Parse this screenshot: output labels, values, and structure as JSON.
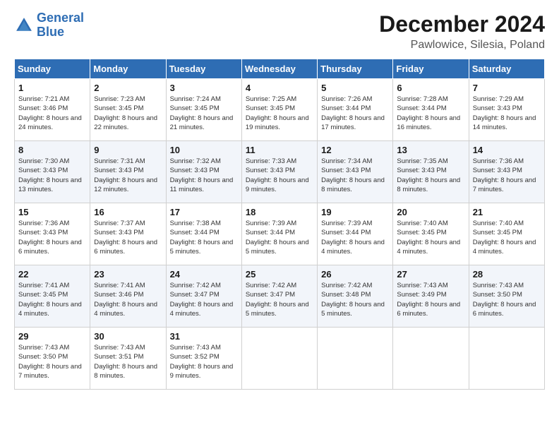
{
  "logo": {
    "line1": "General",
    "line2": "Blue"
  },
  "title": "December 2024",
  "subtitle": "Pawlowice, Silesia, Poland",
  "days_of_week": [
    "Sunday",
    "Monday",
    "Tuesday",
    "Wednesday",
    "Thursday",
    "Friday",
    "Saturday"
  ],
  "weeks": [
    [
      {
        "day": 1,
        "rise": "7:21 AM",
        "set": "3:46 PM",
        "daylight": "8 hours and 24 minutes."
      },
      {
        "day": 2,
        "rise": "7:23 AM",
        "set": "3:45 PM",
        "daylight": "8 hours and 22 minutes."
      },
      {
        "day": 3,
        "rise": "7:24 AM",
        "set": "3:45 PM",
        "daylight": "8 hours and 21 minutes."
      },
      {
        "day": 4,
        "rise": "7:25 AM",
        "set": "3:45 PM",
        "daylight": "8 hours and 19 minutes."
      },
      {
        "day": 5,
        "rise": "7:26 AM",
        "set": "3:44 PM",
        "daylight": "8 hours and 17 minutes."
      },
      {
        "day": 6,
        "rise": "7:28 AM",
        "set": "3:44 PM",
        "daylight": "8 hours and 16 minutes."
      },
      {
        "day": 7,
        "rise": "7:29 AM",
        "set": "3:43 PM",
        "daylight": "8 hours and 14 minutes."
      }
    ],
    [
      {
        "day": 8,
        "rise": "7:30 AM",
        "set": "3:43 PM",
        "daylight": "8 hours and 13 minutes."
      },
      {
        "day": 9,
        "rise": "7:31 AM",
        "set": "3:43 PM",
        "daylight": "8 hours and 12 minutes."
      },
      {
        "day": 10,
        "rise": "7:32 AM",
        "set": "3:43 PM",
        "daylight": "8 hours and 11 minutes."
      },
      {
        "day": 11,
        "rise": "7:33 AM",
        "set": "3:43 PM",
        "daylight": "8 hours and 9 minutes."
      },
      {
        "day": 12,
        "rise": "7:34 AM",
        "set": "3:43 PM",
        "daylight": "8 hours and 8 minutes."
      },
      {
        "day": 13,
        "rise": "7:35 AM",
        "set": "3:43 PM",
        "daylight": "8 hours and 8 minutes."
      },
      {
        "day": 14,
        "rise": "7:36 AM",
        "set": "3:43 PM",
        "daylight": "8 hours and 7 minutes."
      }
    ],
    [
      {
        "day": 15,
        "rise": "7:36 AM",
        "set": "3:43 PM",
        "daylight": "8 hours and 6 minutes."
      },
      {
        "day": 16,
        "rise": "7:37 AM",
        "set": "3:43 PM",
        "daylight": "8 hours and 6 minutes."
      },
      {
        "day": 17,
        "rise": "7:38 AM",
        "set": "3:44 PM",
        "daylight": "8 hours and 5 minutes."
      },
      {
        "day": 18,
        "rise": "7:39 AM",
        "set": "3:44 PM",
        "daylight": "8 hours and 5 minutes."
      },
      {
        "day": 19,
        "rise": "7:39 AM",
        "set": "3:44 PM",
        "daylight": "8 hours and 4 minutes."
      },
      {
        "day": 20,
        "rise": "7:40 AM",
        "set": "3:45 PM",
        "daylight": "8 hours and 4 minutes."
      },
      {
        "day": 21,
        "rise": "7:40 AM",
        "set": "3:45 PM",
        "daylight": "8 hours and 4 minutes."
      }
    ],
    [
      {
        "day": 22,
        "rise": "7:41 AM",
        "set": "3:45 PM",
        "daylight": "8 hours and 4 minutes."
      },
      {
        "day": 23,
        "rise": "7:41 AM",
        "set": "3:46 PM",
        "daylight": "8 hours and 4 minutes."
      },
      {
        "day": 24,
        "rise": "7:42 AM",
        "set": "3:47 PM",
        "daylight": "8 hours and 4 minutes."
      },
      {
        "day": 25,
        "rise": "7:42 AM",
        "set": "3:47 PM",
        "daylight": "8 hours and 5 minutes."
      },
      {
        "day": 26,
        "rise": "7:42 AM",
        "set": "3:48 PM",
        "daylight": "8 hours and 5 minutes."
      },
      {
        "day": 27,
        "rise": "7:43 AM",
        "set": "3:49 PM",
        "daylight": "8 hours and 6 minutes."
      },
      {
        "day": 28,
        "rise": "7:43 AM",
        "set": "3:50 PM",
        "daylight": "8 hours and 6 minutes."
      }
    ],
    [
      {
        "day": 29,
        "rise": "7:43 AM",
        "set": "3:50 PM",
        "daylight": "8 hours and 7 minutes."
      },
      {
        "day": 30,
        "rise": "7:43 AM",
        "set": "3:51 PM",
        "daylight": "8 hours and 8 minutes."
      },
      {
        "day": 31,
        "rise": "7:43 AM",
        "set": "3:52 PM",
        "daylight": "8 hours and 9 minutes."
      },
      null,
      null,
      null,
      null
    ]
  ],
  "labels": {
    "sunrise": "Sunrise:",
    "sunset": "Sunset:",
    "daylight": "Daylight:"
  }
}
